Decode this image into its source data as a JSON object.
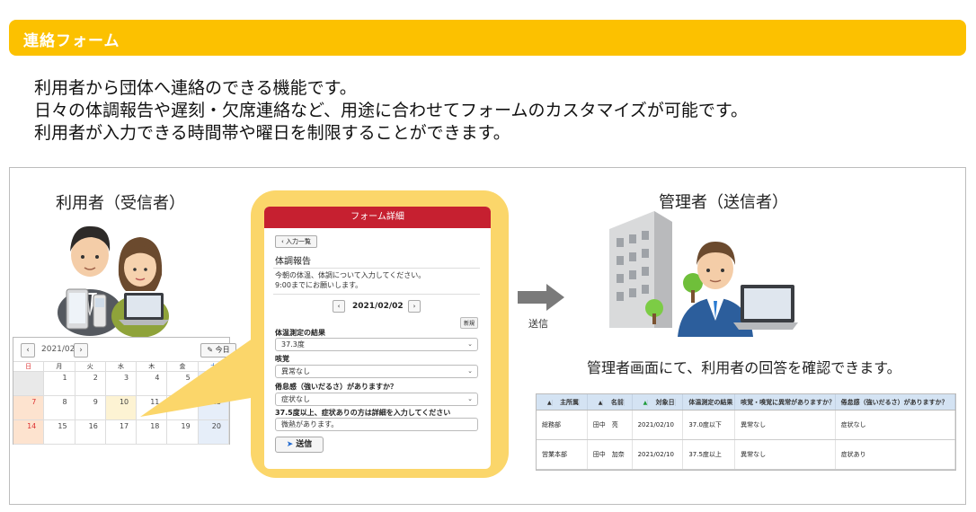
{
  "header": {
    "title": "連絡フォーム",
    "color": "#fcc100"
  },
  "intro": {
    "line1": "利用者から団体へ連絡のできる機能です。",
    "line2": "日々の体調報告や遅刻・欠席連絡など、用途に合わせてフォームのカスタマイズが可能です。",
    "line3": "利用者が入力できる時間帯や曜日を制限することができます。"
  },
  "user_label": "利用者（受信者）",
  "admin_label": "管理者（送信者）",
  "calendar": {
    "prev": "‹",
    "next": "›",
    "month": "2021/02",
    "today_button": "今日",
    "weekdays": [
      "日",
      "月",
      "火",
      "水",
      "木",
      "金",
      "土"
    ],
    "weeks": [
      [
        "",
        "1",
        "2",
        "3",
        "4",
        "5",
        "6"
      ],
      [
        "7",
        "8",
        "9",
        "10",
        "11",
        "12",
        "13"
      ],
      [
        "14",
        "15",
        "16",
        "17",
        "18",
        "19",
        "20"
      ]
    ]
  },
  "form": {
    "header": "フォーム詳細",
    "header_color": "#c62030",
    "back_button": "‹ 入力一覧",
    "title": "体調報告",
    "description_line1": "今朝の体温、体調について入力してください。",
    "description_line2": "9:00までにお願いします。",
    "date_prev": "‹",
    "date": "2021/02/02",
    "date_next": "›",
    "new_badge": "新規",
    "q1_label": "体温測定の結果",
    "q1_value": "37.3度",
    "q2_label": "咳覚",
    "q2_value": "異常なし",
    "q3_label": "倦怠感（強いだるさ）がありますか？",
    "q3_value": "症状なし",
    "q4_label": "37.5度以上、症状ありの方は詳細を入力してください",
    "q4_value": "微熱があります。",
    "submit_button": "送信"
  },
  "arrow_label": "送信",
  "admin_caption": "管理者画面にて、利用者の回答を確認できます。",
  "admin_table": {
    "columns": [
      "主所属",
      "名前",
      "対象日",
      "体温測定の結果",
      "咳覚・嗅覚に異常がありますか？",
      "倦怠感（強いだるさ）がありますか？"
    ],
    "rows": [
      [
        "総務部",
        "田中　亮",
        "2021/02/10",
        "37.0度以下",
        "異常なし",
        "症状なし"
      ],
      [
        "営業本部",
        "田中　加奈",
        "2021/02/10",
        "37.5度以上",
        "異常なし",
        "症状あり"
      ]
    ],
    "header_color": "#d4e3f3"
  }
}
